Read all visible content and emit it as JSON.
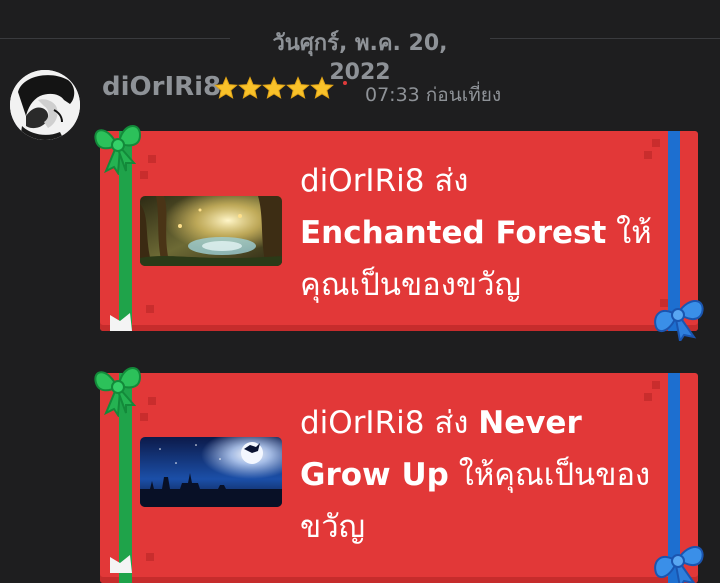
{
  "date_divider": {
    "text": "วันศุกร์, พ.ค. 20, 2022"
  },
  "message": {
    "username": "diOrIRi8",
    "badge": "star-rating-icon",
    "star_count": 5,
    "timestamp": "07:33 ก่อนเที่ยง",
    "accent_color": "#e03a3a"
  },
  "gifts": [
    {
      "sender": "diOrIRi8",
      "verb": "ส่ง",
      "item": "Enchanted Forest",
      "suffix": "ให้คุณเป็นของขวัญ",
      "thumbnail": "enchanted-forest-image"
    },
    {
      "sender": "diOrIRi8",
      "verb": "ส่ง",
      "item": "Never Grow Up",
      "suffix": "ให้คุณเป็นของขวัญ",
      "thumbnail": "never-grow-up-image"
    }
  ],
  "colors": {
    "background": "#1e1e1f",
    "card": "#e23838",
    "ribbon_green": "#1fa34a",
    "ribbon_blue": "#1d6fd0",
    "muted_text": "#8e9297"
  }
}
